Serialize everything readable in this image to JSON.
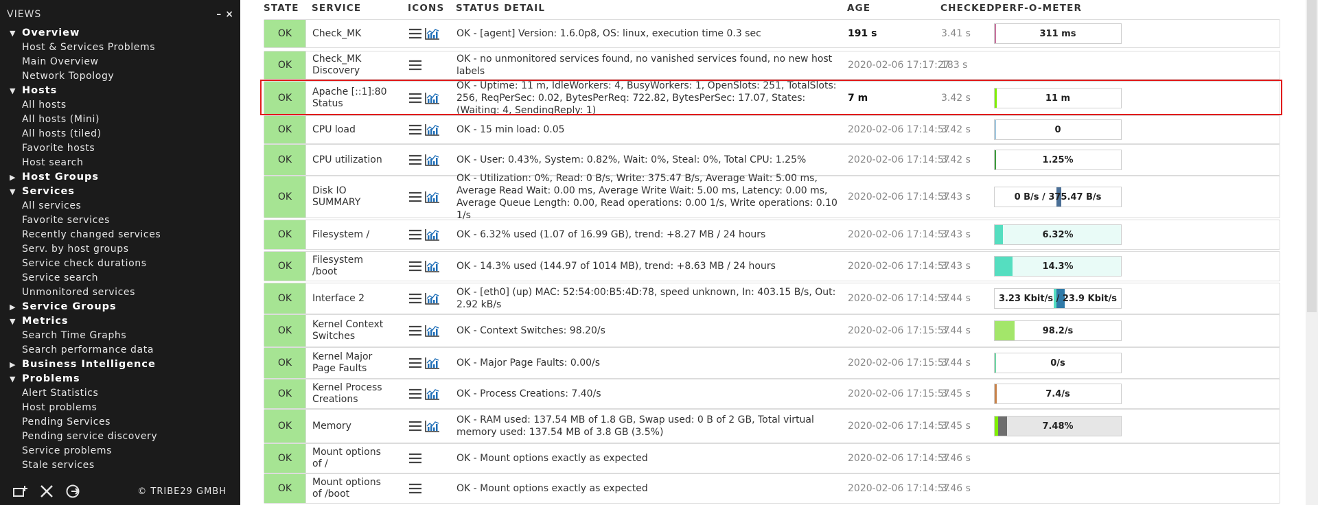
{
  "sidebar": {
    "title": "VIEWS",
    "controls": {
      "minimize": "–",
      "close": "×"
    },
    "sections": [
      {
        "label": "Overview",
        "expanded": true,
        "items": [
          "Host & Services Problems",
          "Main Overview",
          "Network Topology"
        ]
      },
      {
        "label": "Hosts",
        "expanded": true,
        "items": [
          "All hosts",
          "All hosts (Mini)",
          "All hosts (tiled)",
          "Favorite hosts",
          "Host search"
        ]
      },
      {
        "label": "Host Groups",
        "expanded": false,
        "items": []
      },
      {
        "label": "Services",
        "expanded": true,
        "items": [
          "All services",
          "Favorite services",
          "Recently changed services",
          "Serv. by host groups",
          "Service check durations",
          "Service search",
          "Unmonitored services"
        ]
      },
      {
        "label": "Service Groups",
        "expanded": false,
        "items": []
      },
      {
        "label": "Metrics",
        "expanded": true,
        "items": [
          "Search Time Graphs",
          "Search performance data"
        ]
      },
      {
        "label": "Business Intelligence",
        "expanded": false,
        "items": []
      },
      {
        "label": "Problems",
        "expanded": true,
        "items": [
          "Alert Statistics",
          "Host problems",
          "Pending Services",
          "Pending service discovery",
          "Service problems",
          "Stale services"
        ]
      }
    ],
    "footer": {
      "copyright": "© TRIBE29 GMBH",
      "icons": [
        "add-snapin-icon",
        "edit-icon",
        "logout-icon"
      ]
    }
  },
  "table": {
    "headers": {
      "state": "STATE",
      "service": "SERVICE",
      "icons": "ICONS",
      "detail": "STATUS DETAIL",
      "age": "AGE",
      "checked": "CHECKED",
      "perf": "PERF-O-METER"
    },
    "rows": [
      {
        "state": "OK",
        "service": "Check_MK",
        "detail": "OK - [agent] Version: 1.6.0p8, OS: linux, execution time 0.3 sec",
        "age": "191 s",
        "age_fresh": true,
        "checked": "3.41 s",
        "graph": true,
        "perf": {
          "label": "311 ms",
          "pct": 0.01,
          "color": "#c8719e"
        }
      },
      {
        "state": "OK",
        "service": "Check_MK Discovery",
        "detail": "OK - no unmonitored services found, no vanished services found, no new host labels",
        "age": "2020-02-06 17:17:27",
        "age_fresh": false,
        "checked": "183 s",
        "graph": false,
        "perf": null
      },
      {
        "state": "OK",
        "service": "Apache [::1]:80 Status",
        "detail": "OK - Uptime: 11 m, IdleWorkers: 4, BusyWorkers: 1, OpenSlots: 251, TotalSlots: 256, ReqPerSec: 0.02, BytesPerReq: 722.82, BytesPerSec: 17.07, States: (Waiting: 4, SendingReply: 1)",
        "age": "7 m",
        "age_fresh": true,
        "checked": "3.42 s",
        "graph": true,
        "perf": {
          "label": "11 m",
          "pct": 0.015,
          "color": "#80f000"
        }
      },
      {
        "state": "OK",
        "service": "CPU load",
        "detail": "OK - 15 min load: 0.05",
        "age": "2020-02-06 17:14:57",
        "age_fresh": false,
        "checked": "3.42 s",
        "graph": true,
        "perf": {
          "label": "0",
          "pct": 0.005,
          "color": "#9ec6e0"
        }
      },
      {
        "state": "OK",
        "service": "CPU utilization",
        "detail": "OK - User: 0.43%, System: 0.82%, Wait: 0%, Steal: 0%, Total CPU: 1.25%",
        "age": "2020-02-06 17:14:57",
        "age_fresh": false,
        "checked": "3.42 s",
        "graph": true,
        "perf": {
          "label": "1.25%",
          "pct": 0.0125,
          "color": "#3c9c3c"
        }
      },
      {
        "state": "OK",
        "service": "Disk IO SUMMARY",
        "detail": "OK - Utilization: 0%, Read: 0 B/s, Write: 375.47 B/s, Average Wait: 5.00 ms, Average Read Wait: 0.00 ms, Average Write Wait: 5.00 ms, Latency: 0.00 ms, Average Queue Length: 0.00, Read operations: 0.00 1/s, Write operations: 0.10 1/s",
        "age": "2020-02-06 17:14:57",
        "age_fresh": false,
        "checked": "3.43 s",
        "graph": true,
        "perf": {
          "label": "0 B/s / 375.47 B/s",
          "pct": 0.5,
          "color": "#4a6f96",
          "center_bar": true
        }
      },
      {
        "state": "OK",
        "service": "Filesystem /",
        "detail": "OK - 6.32% used (1.07 of 16.99 GB), trend: +8.27 MB / 24 hours",
        "age": "2020-02-06 17:14:57",
        "age_fresh": false,
        "checked": "3.43 s",
        "graph": true,
        "perf": {
          "label": "6.32%",
          "pct": 0.0632,
          "color": "#55dec0",
          "bg": "#e9fbf7"
        }
      },
      {
        "state": "OK",
        "service": "Filesystem /boot",
        "detail": "OK - 14.3% used (144.97 of 1014 MB), trend: +8.63 MB / 24 hours",
        "age": "2020-02-06 17:14:57",
        "age_fresh": false,
        "checked": "3.43 s",
        "graph": true,
        "perf": {
          "label": "14.3%",
          "pct": 0.143,
          "color": "#55dec0",
          "bg": "#e9fbf7"
        }
      },
      {
        "state": "OK",
        "service": "Interface 2",
        "detail": "OK - [eth0] (up) MAC: 52:54:00:B5:4D:78, speed unknown, In: 403.15 B/s, Out: 2.92 kB/s",
        "age": "2020-02-06 17:14:57",
        "age_fresh": false,
        "checked": "3.44 s",
        "graph": true,
        "perf": {
          "label": "3.23 Kbit/s / 23.9 Kbit/s",
          "pct": 0.5,
          "color": "#2f7aa8",
          "center_bar": true,
          "wide": true
        }
      },
      {
        "state": "OK",
        "service": "Kernel Context Switches",
        "detail": "OK - Context Switches: 98.20/s",
        "age": "2020-02-06 17:15:57",
        "age_fresh": false,
        "checked": "3.44 s",
        "graph": true,
        "perf": {
          "label": "98.2/s",
          "pct": 0.16,
          "color": "#a3e66a"
        }
      },
      {
        "state": "OK",
        "service": "Kernel Major Page Faults",
        "detail": "OK - Major Page Faults: 0.00/s",
        "age": "2020-02-06 17:15:57",
        "age_fresh": false,
        "checked": "3.44 s",
        "graph": true,
        "perf": {
          "label": "0/s",
          "pct": 0.005,
          "color": "#6ed7a4"
        }
      },
      {
        "state": "OK",
        "service": "Kernel Process Creations",
        "detail": "OK - Process Creations: 7.40/s",
        "age": "2020-02-06 17:15:57",
        "age_fresh": false,
        "checked": "3.45 s",
        "graph": true,
        "perf": {
          "label": "7.4/s",
          "pct": 0.015,
          "color": "#c8824a"
        }
      },
      {
        "state": "OK",
        "service": "Memory",
        "detail": "OK - RAM used: 137.54 MB of 1.8 GB, Swap used: 0 B of 2 GB, Total virtual memory used: 137.54 MB of 3.8 GB (3.5%)",
        "age": "2020-02-06 17:14:57",
        "age_fresh": false,
        "checked": "3.45 s",
        "graph": true,
        "perf": {
          "label": "7.48%",
          "pct": 0.1,
          "color": "#6e6e6e",
          "bg": "#e6e6e6",
          "leadcolor": "#80f000"
        }
      },
      {
        "state": "OK",
        "service": "Mount options of /",
        "detail": "OK - Mount options exactly as expected",
        "age": "2020-02-06 17:14:57",
        "age_fresh": false,
        "checked": "3.46 s",
        "graph": false,
        "perf": null
      },
      {
        "state": "OK",
        "service": "Mount options of /boot",
        "detail": "OK - Mount options exactly as expected",
        "age": "2020-02-06 17:14:57",
        "age_fresh": false,
        "checked": "3.46 s",
        "graph": false,
        "perf": null
      }
    ]
  },
  "colors": {
    "ok": "#a6e493",
    "highlight": "#e11b1b",
    "sidebar_bg": "#1b1b1b"
  }
}
